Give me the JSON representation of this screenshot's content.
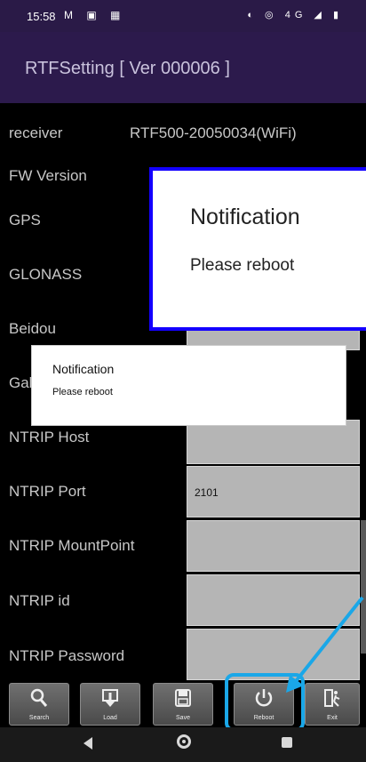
{
  "status_bar": {
    "time": "15:58",
    "left_icons": "M ▣ ▦",
    "right_icons": "◐ ◎ 4G ◢ ▮"
  },
  "app_bar": {
    "title": "RTFSetting [ Ver 000006 ]"
  },
  "rows": [
    {
      "label": "receiver",
      "value": "RTF500-20050034(WiFi)"
    },
    {
      "label": "FW Version"
    },
    {
      "label": "GPS"
    },
    {
      "label": "GLONASS"
    },
    {
      "label": "Beidou"
    },
    {
      "label": "Gal"
    },
    {
      "label": "NTRIP Host"
    },
    {
      "label": "NTRIP Port",
      "field_value": "2101"
    },
    {
      "label": "NTRIP MountPoint"
    },
    {
      "label": "NTRIP id"
    },
    {
      "label": "NTRIP Password"
    }
  ],
  "dialog_zoom": {
    "title": "Notification",
    "message": "Please reboot"
  },
  "dialog": {
    "title": "Notification",
    "message": "Please reboot"
  },
  "toolbar": {
    "buttons": [
      {
        "label": "Search",
        "icon": "search-icon"
      },
      {
        "label": "Load",
        "icon": "download-icon"
      },
      {
        "label": "Save",
        "icon": "floppy-icon"
      },
      {
        "label": "Reboot",
        "icon": "power-icon"
      },
      {
        "label": "Exit",
        "icon": "exit-icon"
      }
    ]
  },
  "colors": {
    "app_bar": "#2c1a4c",
    "highlight": "#1aa7e8",
    "zoom_border": "#1400ff"
  }
}
